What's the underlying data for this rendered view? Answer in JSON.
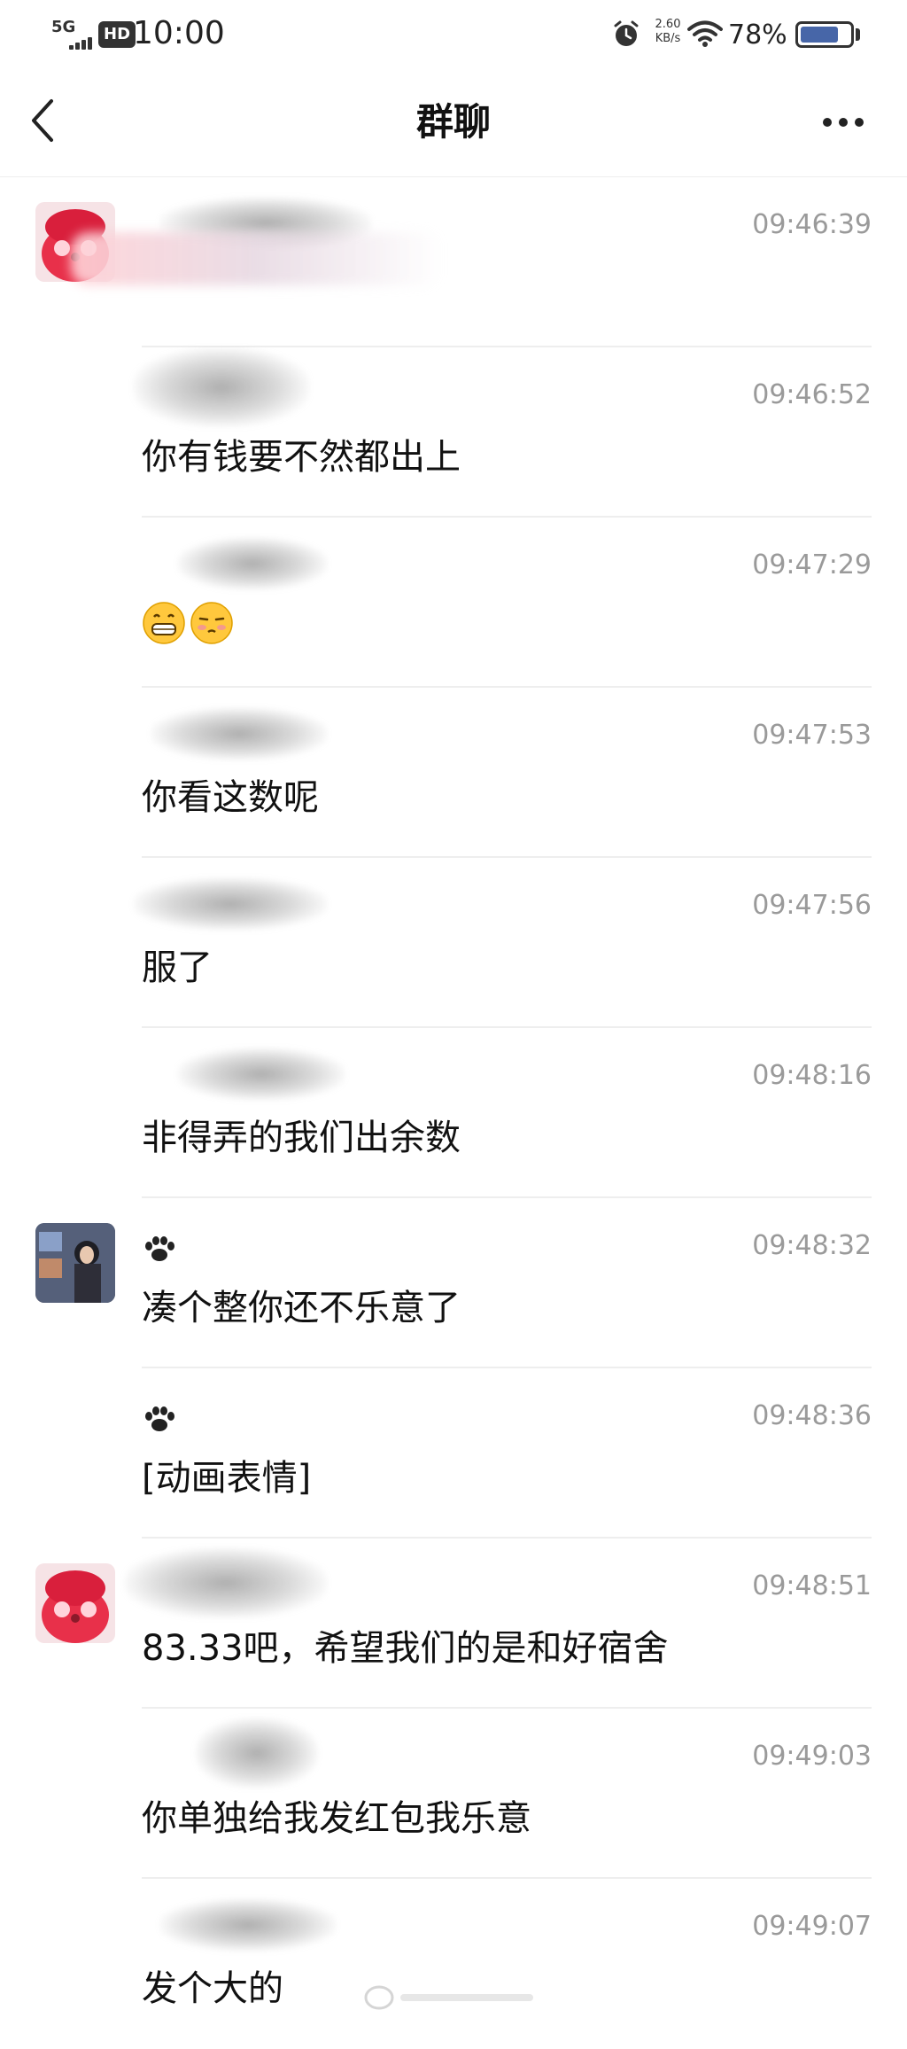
{
  "status_bar": {
    "network": "5G",
    "hd": "HD",
    "time": "10:00",
    "net_speed_value": "2.60",
    "net_speed_unit": "KB/s",
    "battery_percent": "78%",
    "battery_level": 0.78,
    "battery_color": "#4766a8"
  },
  "nav": {
    "title": "群聊",
    "back_icon": "chevron-left-icon",
    "more_icon": "more-horizontal-icon"
  },
  "messages": [
    {
      "sender": "",
      "time": "09:46:39",
      "text": ""
    },
    {
      "sender": "",
      "time": "09:46:52",
      "text": "你有钱要不然都出上"
    },
    {
      "sender": "",
      "time": "09:47:29",
      "text": "",
      "emoji": [
        "grinning-face-emoji",
        "smirking-face-emoji"
      ]
    },
    {
      "sender": "",
      "time": "09:47:53",
      "text": "你看这数呢"
    },
    {
      "sender": "",
      "time": "09:47:56",
      "text": "服了"
    },
    {
      "sender": "",
      "time": "09:48:16",
      "text": "非得弄的我们出余数"
    },
    {
      "sender": "paw-icon",
      "time": "09:48:32",
      "text": "凑个整你还不乐意了"
    },
    {
      "sender": "paw-icon",
      "time": "09:48:36",
      "text": "[动画表情]"
    },
    {
      "sender": "",
      "time": "09:48:51",
      "text": "83.33吧，希望我们的是和好宿舍"
    },
    {
      "sender": "",
      "time": "09:49:03",
      "text": "你单独给我发红包我乐意"
    },
    {
      "sender": "",
      "time": "09:49:07",
      "text": "发个大的"
    }
  ],
  "colors": {
    "time_text": "#9a9a9a",
    "divider": "#eeeeee",
    "accent_red": "#e8304a"
  }
}
